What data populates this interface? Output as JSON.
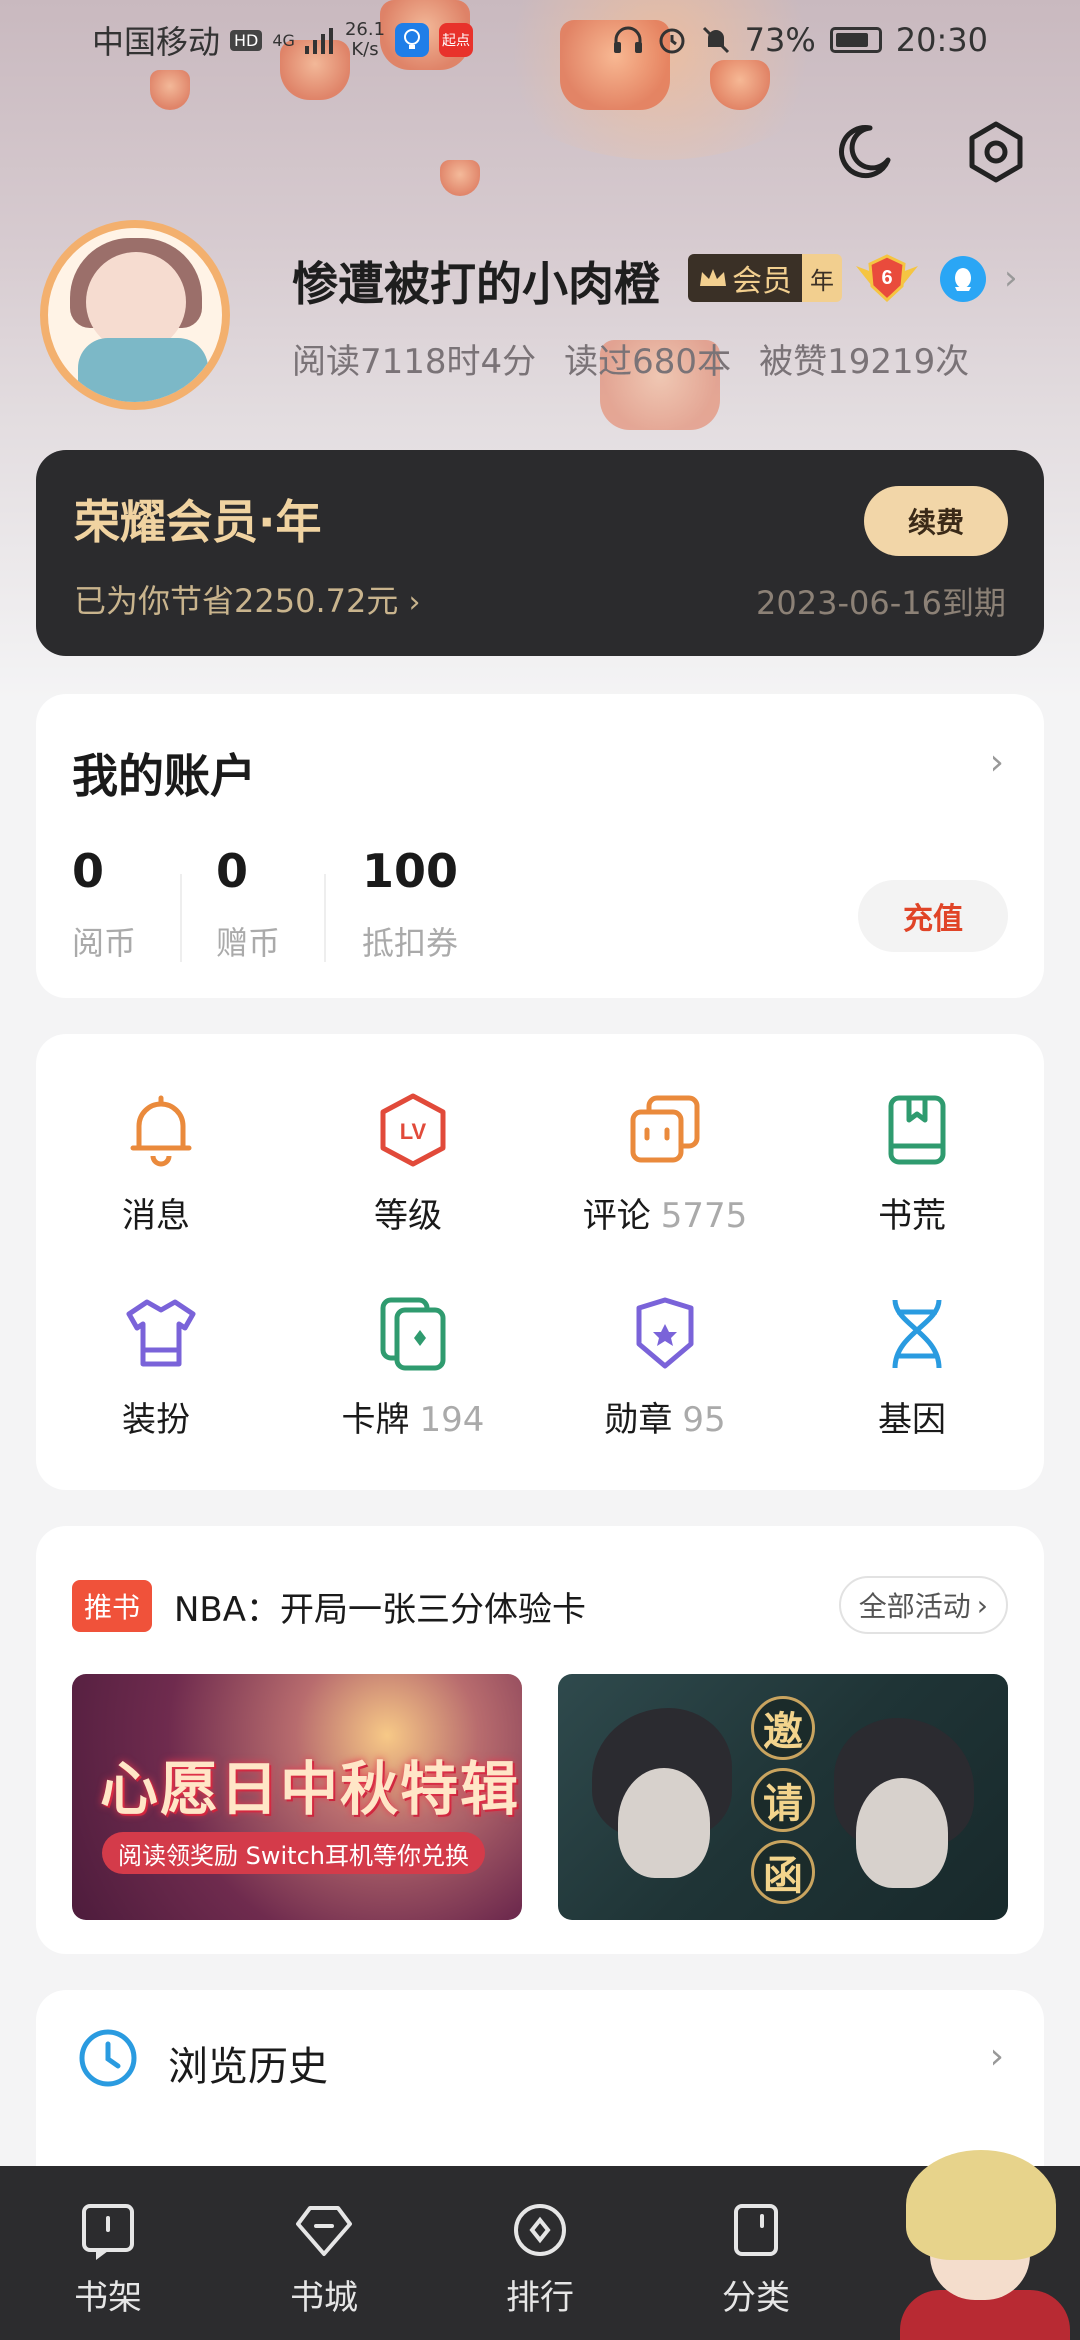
{
  "status_bar": {
    "carrier": "中国移动",
    "hd": "HD",
    "net": "4G",
    "speed_value": "26.1",
    "speed_unit": "K/s",
    "app2": "起点",
    "battery": "73%",
    "time": "20:30"
  },
  "profile": {
    "name": "惨遭被打的小肉橙",
    "vip_label": "会员",
    "vip_period": "年",
    "level": "6",
    "stats": [
      "阅读7118时4分",
      "读过680本",
      "被赞19219次"
    ]
  },
  "vip_card": {
    "title": "荣耀会员·年",
    "saved": "已为你节省2250.72元",
    "renew_button": "续费",
    "expires": "2023-06-16到期"
  },
  "account": {
    "title": "我的账户",
    "items": [
      {
        "value": "0",
        "label": "阅币"
      },
      {
        "value": "0",
        "label": "赠币"
      },
      {
        "value": "100",
        "label": "抵扣券"
      }
    ],
    "recharge_button": "充值"
  },
  "features": [
    {
      "label": "消息",
      "count": "",
      "icon": "bell-icon"
    },
    {
      "label": "等级",
      "count": "",
      "icon": "level-icon"
    },
    {
      "label": "评论",
      "count": "5775",
      "icon": "comment-icon"
    },
    {
      "label": "书荒",
      "count": "",
      "icon": "book-icon"
    },
    {
      "label": "装扮",
      "count": "",
      "icon": "shirt-icon"
    },
    {
      "label": "卡牌",
      "count": "194",
      "icon": "cards-icon"
    },
    {
      "label": "勋章",
      "count": "95",
      "icon": "badge-icon"
    },
    {
      "label": "基因",
      "count": "",
      "icon": "dna-icon"
    }
  ],
  "promo": {
    "tag": "推书",
    "headline": "NBA：开局一张三分体验卡",
    "all_button": "全部活动",
    "banner1_title": "心愿日中秋特辑",
    "banner1_sub": "阅读领奖励 Switch耳机等你兑换",
    "banner2_chars": [
      "邀",
      "请",
      "函"
    ]
  },
  "history": {
    "label": "浏览历史"
  },
  "bottom_nav": [
    "书架",
    "书城",
    "排行",
    "分类"
  ],
  "colors": {
    "accent_red": "#e04427",
    "vip_gold": "#f0d3a1",
    "nav_bg": "#2c2c2e"
  }
}
